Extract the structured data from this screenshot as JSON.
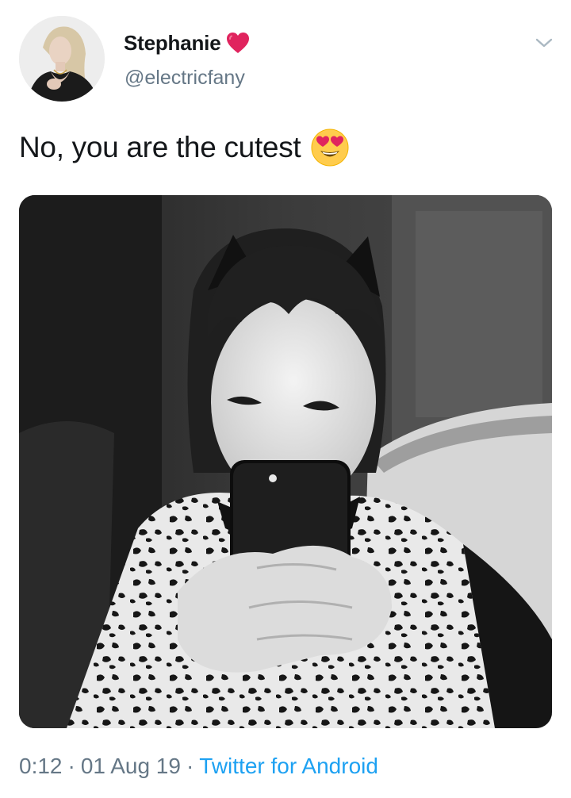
{
  "author": {
    "display_name": "Stephanie",
    "handle": "@electricfany",
    "name_emoji": "red-heart-icon",
    "avatar": "profile-photo"
  },
  "tweet": {
    "text": "No, you are the cutest",
    "text_emoji": "smiling-face-with-heart-eyes-icon",
    "media": "black-and-white-photo"
  },
  "meta": {
    "time": "0:12",
    "separator": "·",
    "date": "01 Aug 19",
    "source": "Twitter for Android"
  },
  "colors": {
    "text": "#14171a",
    "secondary": "#657786",
    "link": "#1da1f2",
    "heart": "#e0245e"
  }
}
